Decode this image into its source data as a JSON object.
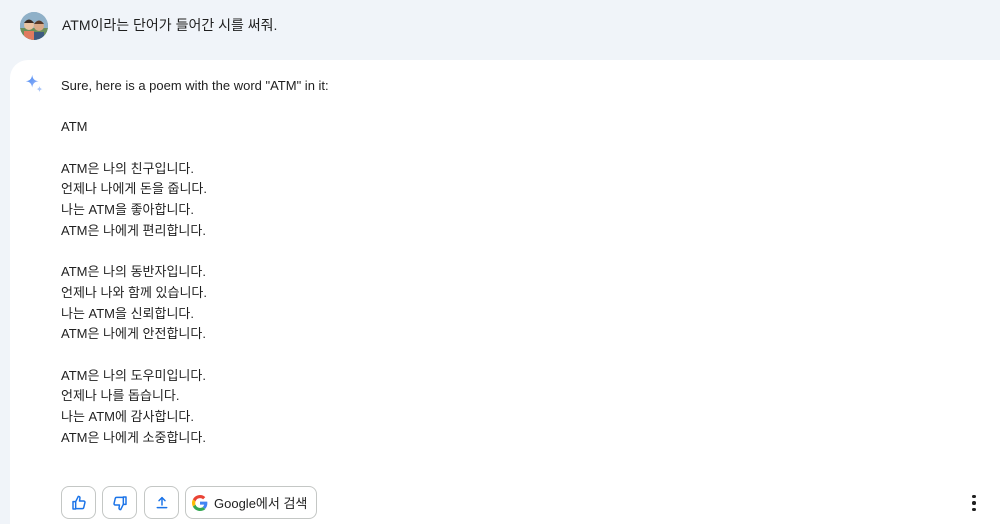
{
  "user_prompt": {
    "text": "ATM이라는 단어가 들어간 시를 써줘."
  },
  "response": {
    "intro": "Sure, here is a poem with the word \"ATM\" in it:",
    "poem_title": "ATM",
    "stanzas": [
      [
        "ATM은 나의 친구입니다.",
        "언제나 나에게 돈을 줍니다.",
        "나는 ATM을 좋아합니다.",
        "ATM은 나에게 편리합니다."
      ],
      [
        "ATM은 나의 동반자입니다.",
        "언제나 나와 함께 있습니다.",
        "나는 ATM을 신뢰합니다.",
        "ATM은 나에게 안전합니다."
      ],
      [
        "ATM은 나의 도우미입니다.",
        "언제나 나를 돕습니다.",
        "나는 ATM에 감사합니다.",
        "ATM은 나에게 소중합니다."
      ]
    ]
  },
  "actions": {
    "google_search_label": "Google에서 검색"
  },
  "icons": {
    "gemini": "sparkle-icon",
    "thumbs_up": "thumbs-up-icon",
    "thumbs_down": "thumbs-down-icon",
    "share": "share-icon",
    "google": "google-g-icon",
    "more": "more-vert-icon"
  },
  "colors": {
    "page_bg": "#f0f4f9",
    "card_bg": "#ffffff",
    "sparkle": "#4285f4",
    "google_blue": "#4285f4",
    "google_red": "#ea4335",
    "google_yellow": "#fbbc05",
    "google_green": "#34a853"
  }
}
